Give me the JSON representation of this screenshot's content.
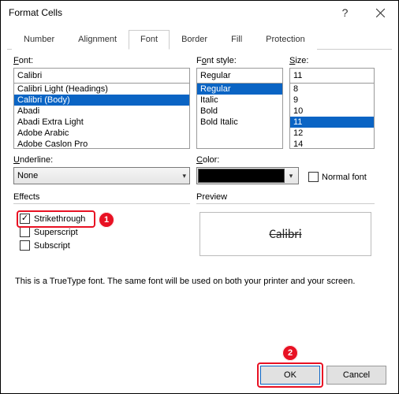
{
  "window": {
    "title": "Format Cells"
  },
  "tabs": [
    "Number",
    "Alignment",
    "Font",
    "Border",
    "Fill",
    "Protection"
  ],
  "active_tab": "Font",
  "font": {
    "label_html": "Font:",
    "value": "Calibri",
    "options": [
      "Calibri Light (Headings)",
      "Calibri (Body)",
      "Abadi",
      "Abadi Extra Light",
      "Adobe Arabic",
      "Adobe Caslon Pro"
    ],
    "selected": "Calibri (Body)"
  },
  "style": {
    "label": "Font style:",
    "value": "Regular",
    "options": [
      "Regular",
      "Italic",
      "Bold",
      "Bold Italic"
    ],
    "selected": "Regular"
  },
  "size": {
    "label_html": "Size:",
    "value": "11",
    "options": [
      "8",
      "9",
      "10",
      "11",
      "12",
      "14"
    ],
    "selected": "11"
  },
  "underline": {
    "label_html": "Underline:",
    "value": "None"
  },
  "color": {
    "label_html": "Color:",
    "value": "#000000"
  },
  "normal_font_label": "Normal font",
  "effects": {
    "label": "Effects",
    "strikethrough": {
      "label": "Strikethrough",
      "checked": true
    },
    "superscript": {
      "label": "Superscript",
      "checked": false
    },
    "subscript": {
      "label": "Subscript",
      "checked": false
    }
  },
  "preview": {
    "label": "Preview",
    "sample": "Calibri"
  },
  "description": "This is a TrueType font.  The same font will be used on both your printer and your screen.",
  "buttons": {
    "ok": "OK",
    "cancel": "Cancel"
  },
  "annotations": {
    "1": "1",
    "2": "2"
  }
}
